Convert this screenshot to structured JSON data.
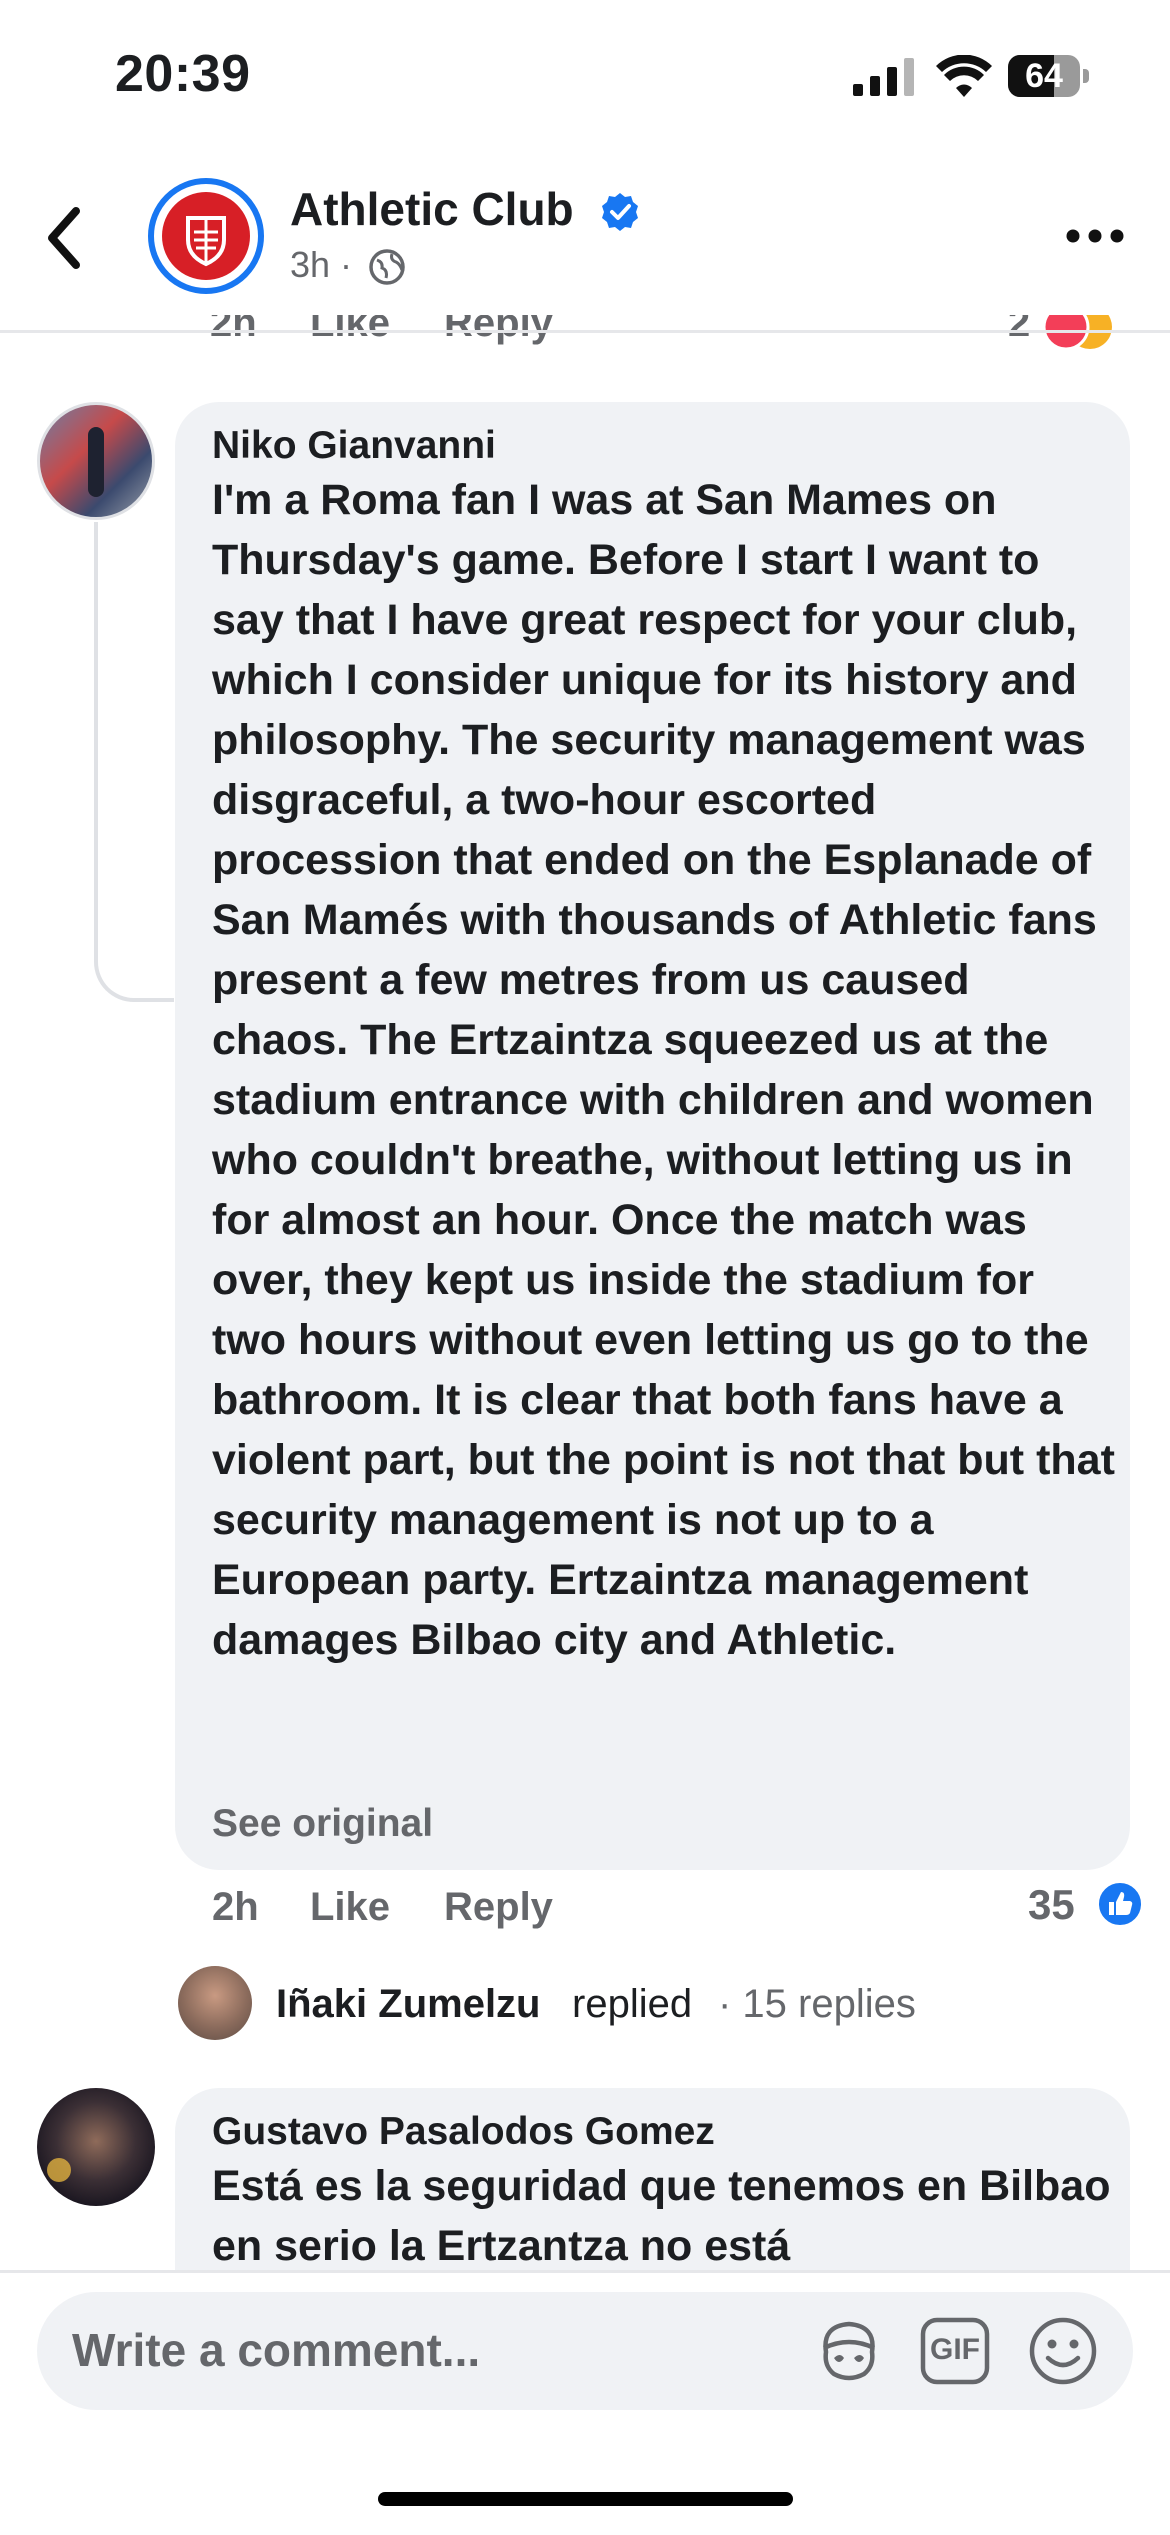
{
  "status_bar": {
    "time": "20:39",
    "battery": "64",
    "battery_level": 0.64
  },
  "header": {
    "page_name": "Athletic Club",
    "post_age": "3h ·",
    "icons": {
      "back": "chevron-left-icon",
      "verified": "verified-badge-icon",
      "audience": "globe-icon",
      "more": "more-horizontal-icon"
    }
  },
  "previous_comment_row": {
    "time": "2h",
    "like": "Like",
    "reply": "Reply",
    "reaction_count": "2"
  },
  "comments": [
    {
      "author": "Niko Gianvanni",
      "text": "I'm a Roma fan I was at San Mames on Thursday's game. Before I start I want to say that I have great respect for your club, which I consider unique for its history and philosophy. The security management was disgraceful, a two-hour escorted procession that ended on the Esplanade of San Mamés with thousands of Athletic fans present a few metres from us caused chaos. The Ertzaintza squeezed us at the stadium entrance with children and women who couldn't breathe, without letting us in for almost an hour. Once the match was over, they kept us inside the stadium for two hours without even letting us go to the bathroom. It is clear that both fans have a violent part, but the point is not that but that security management is not up to a European party. Ertzaintza management damages Bilbao city and Athletic.",
      "see_original": "See original",
      "time": "2h",
      "like": "Like",
      "reply": "Reply",
      "reaction_count": "35",
      "replies": {
        "author": "Iñaki Zumelzu",
        "replied": "replied",
        "count": "· 15 replies"
      }
    },
    {
      "author": "Gustavo Pasalodos Gomez",
      "text": "Está es la seguridad que tenemos en Bilbao en serio la Ertzantza no está"
    }
  ],
  "composer": {
    "placeholder": "Write a comment...",
    "gif_label": "GIF",
    "icons": {
      "avatar_sticker": "avatar-sticker-icon",
      "gif": "gif-icon",
      "emoji": "emoji-icon"
    }
  },
  "colors": {
    "accent": "#1877f2",
    "bubble": "#f0f2f5",
    "secondary_text": "#65676b",
    "club_red": "#d71f26"
  }
}
